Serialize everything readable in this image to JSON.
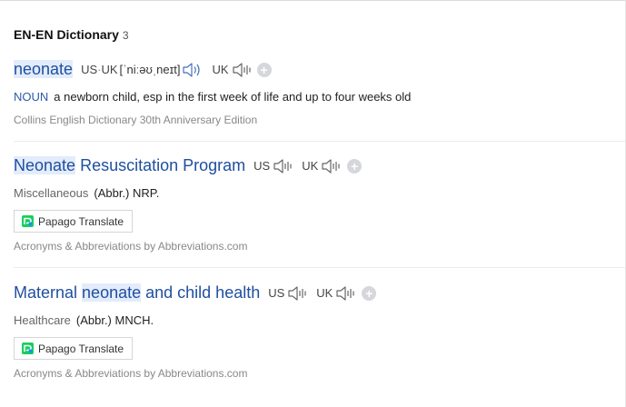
{
  "section": {
    "title": "EN-EN Dictionary",
    "count": "3"
  },
  "entries": [
    {
      "headword": {
        "hl": "neonate",
        "rest": ""
      },
      "pron": {
        "us_label": "US",
        "dot": "·",
        "uk_label": "UK",
        "phonetic": "[ˈniːəʊˌneɪt]",
        "uk2_label": "UK"
      },
      "pos": "NOUN",
      "definition": "a newborn child, esp in the first week of life and up to four weeks old",
      "source": "Collins English Dictionary 30th Anniversary Edition"
    },
    {
      "headword": {
        "hl": "Neonate",
        "rest": " Resuscitation Program"
      },
      "pron": {
        "us_label": "US",
        "uk_label": "UK"
      },
      "category": "Miscellaneous",
      "abbr": "(Abbr.) NRP.",
      "button": "Papago Translate",
      "source": "Acronyms & Abbreviations by Abbreviations.com"
    },
    {
      "headword": {
        "pre": "Maternal ",
        "hl": "neonate",
        "rest": " and child health"
      },
      "pron": {
        "us_label": "US",
        "uk_label": "UK"
      },
      "category": "Healthcare",
      "abbr": "(Abbr.) MNCH.",
      "button": "Papago Translate",
      "source": "Acronyms & Abbreviations by Abbreviations.com"
    }
  ],
  "icons": {
    "speaker": "speaker-icon",
    "add": "plus-icon",
    "papago": "papago-logo-icon"
  },
  "colors": {
    "link": "#1f4fa0",
    "highlight": "#e3ecfb",
    "pos": "#2d5aa8",
    "source": "#888888"
  }
}
